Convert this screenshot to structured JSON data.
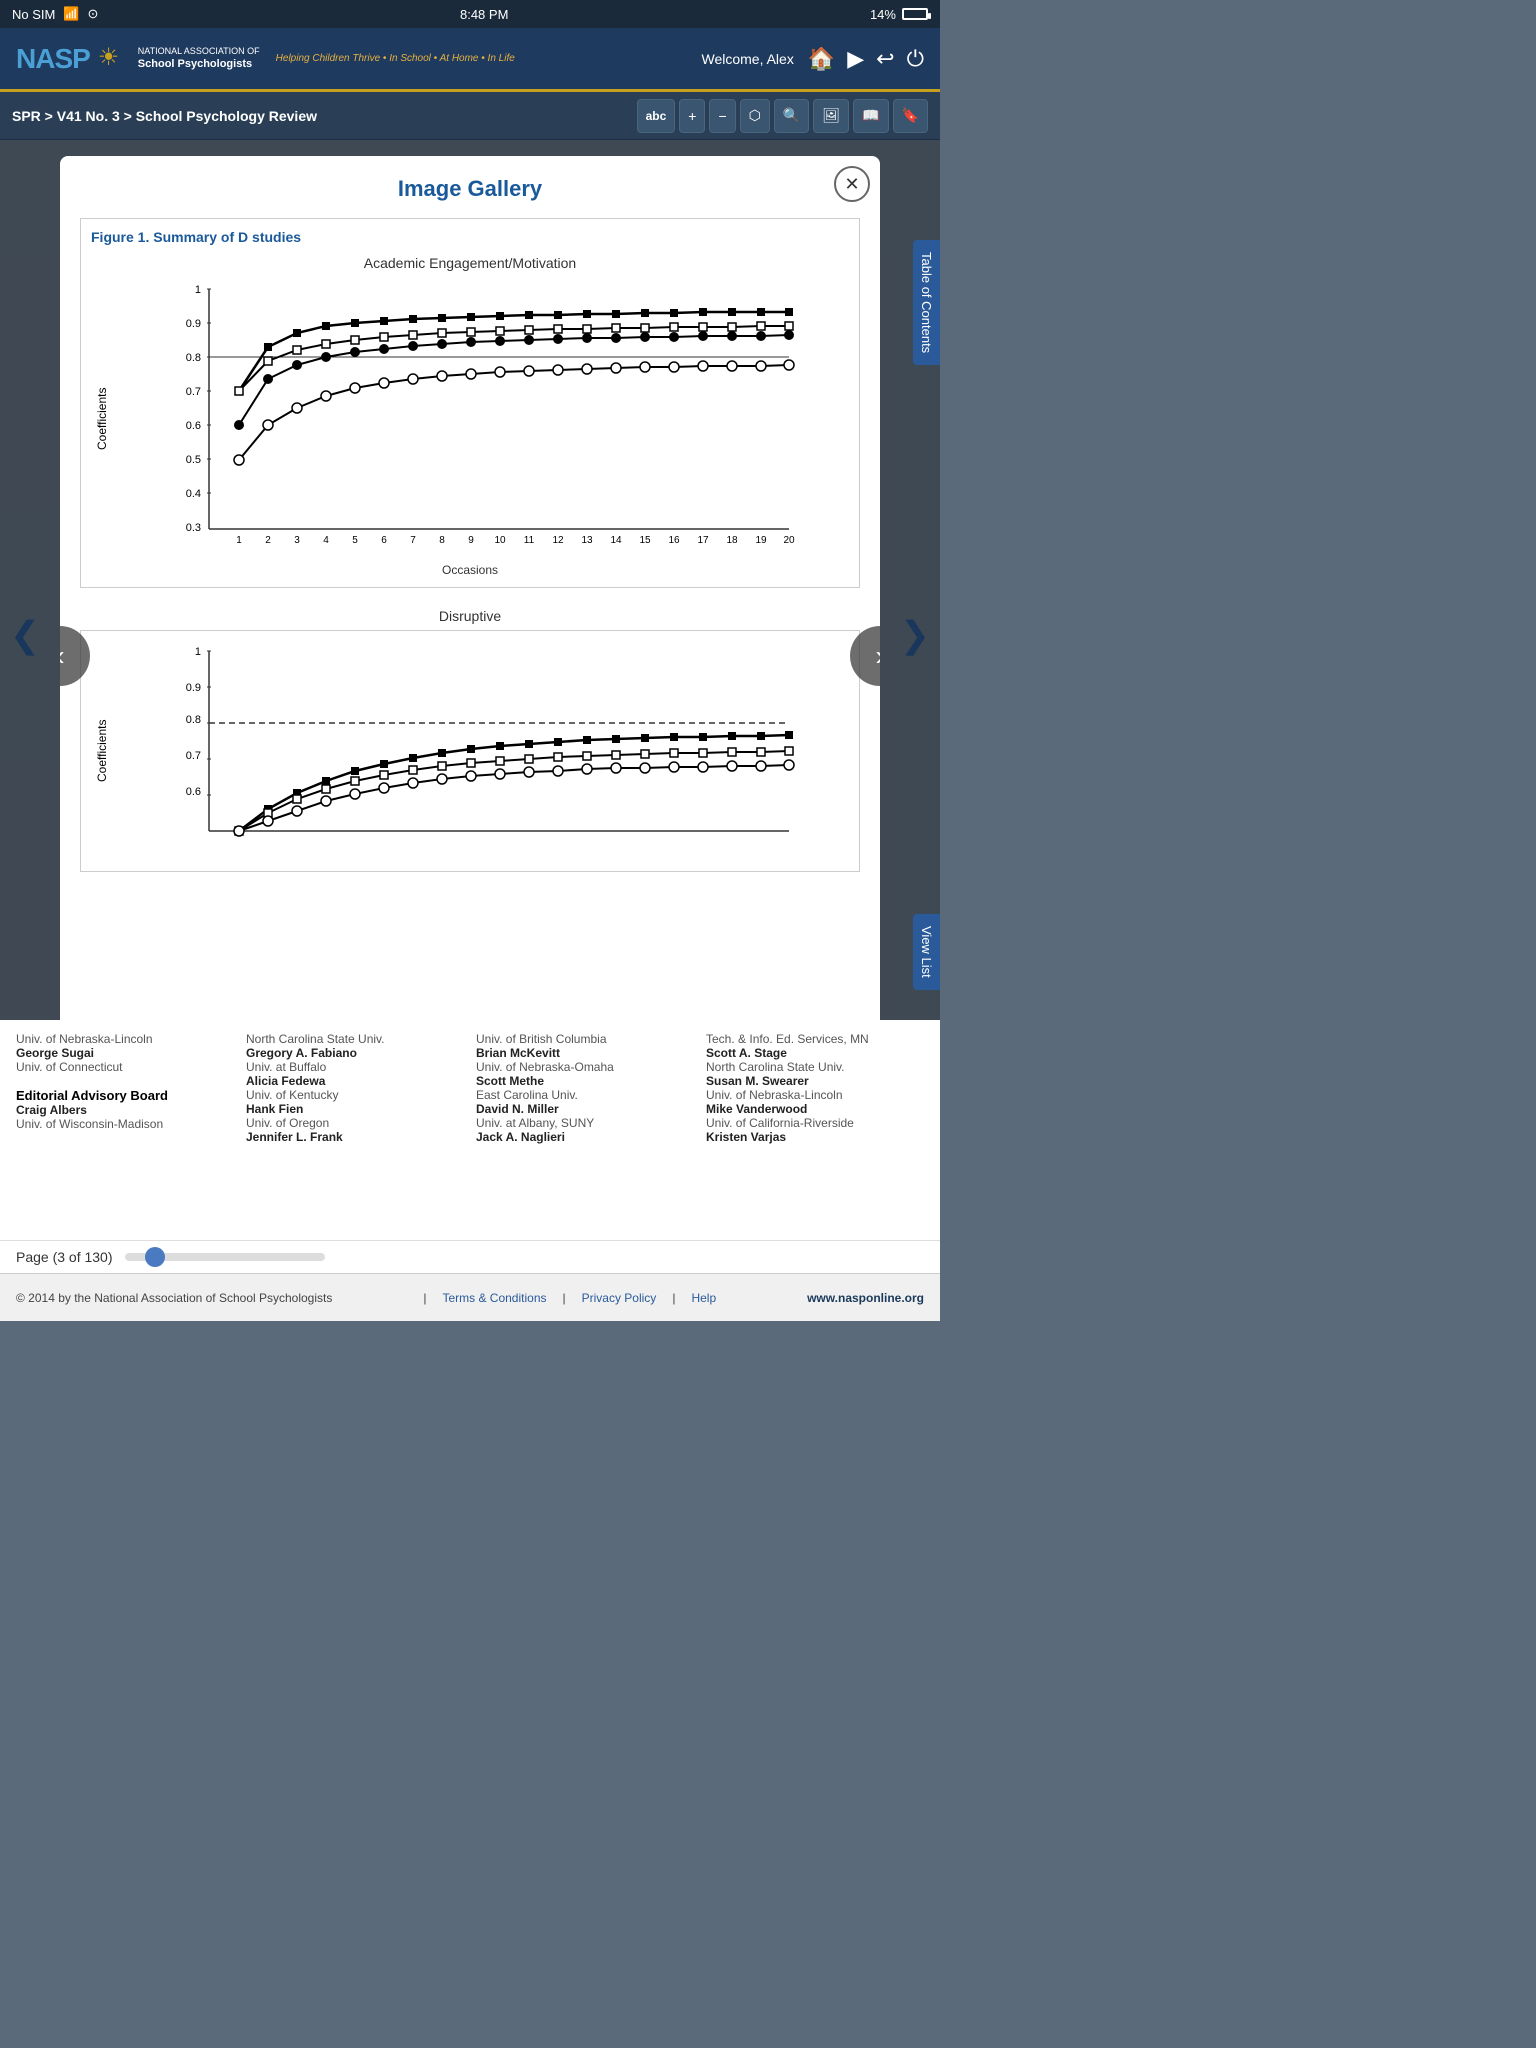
{
  "statusBar": {
    "carrier": "No SIM",
    "wifi": "WiFi",
    "time": "8:48 PM",
    "battery_pct": "14%"
  },
  "header": {
    "nasp_text": "NASP",
    "org_line1": "NATIONAL ASSOCIATION OF",
    "org_line2": "School Psychologists",
    "tagline": "Helping Children Thrive • In School • At Home • In Life",
    "welcome": "Welcome, Alex"
  },
  "navbar": {
    "breadcrumb": "SPR > V41 No. 3 > School Psychology Review",
    "toolbar": {
      "abc_label": "abc",
      "zoom_in": "+",
      "zoom_out": "−"
    }
  },
  "toc_tab": "Table of Contents",
  "view_list_btn": "View List",
  "gallery": {
    "title": "Image Gallery",
    "figure1_title": "Figure 1. Summary of D studies",
    "chart1": {
      "title": "Academic Engagement/Motivation",
      "y_label": "Coefficients",
      "x_label": "Occasions",
      "y_ticks": [
        "1",
        "0.9",
        "0.8",
        "0.7",
        "0.6",
        "0.5",
        "0.4",
        "0.3"
      ],
      "x_ticks": [
        "1",
        "2",
        "3",
        "4",
        "5",
        "6",
        "7",
        "8",
        "9",
        "10",
        "11",
        "12",
        "13",
        "14",
        "15",
        "16",
        "17",
        "18",
        "19",
        "20"
      ]
    },
    "chart2": {
      "title": "Disruptive",
      "y_label": "Coefficients",
      "x_label": "",
      "y_ticks": [
        "1",
        "0.9",
        "0.8",
        "0.7",
        "0.6"
      ]
    },
    "nav_prev": "‹",
    "nav_next": "›",
    "close": "✕"
  },
  "editorial": {
    "cols": [
      {
        "institution1": "Univ. of Nebraska-Lincoln",
        "name1": "George Sugai",
        "institution2": "Univ. of Connecticut",
        "sectionHeader": "Editorial Advisory Board",
        "name3": "Craig Albers",
        "institution3": "Univ. of Wisconsin-Madison"
      },
      {
        "institution1": "North Carolina State Univ.",
        "name1": "Gregory A. Fabiano",
        "institution2": "Univ. at Buffalo",
        "name2": "Alicia Fedewa",
        "institution2b": "Univ. of Kentucky",
        "name3": "Hank Fien",
        "institution3": "Univ. of Oregon",
        "name4": "Jennifer L. Frank"
      },
      {
        "institution1": "Univ. of British Columbia",
        "name1": "Brian McKevitt",
        "institution2": "Univ. of Nebraska-Omaha",
        "name2": "Scott Methe",
        "institution2b": "East Carolina Univ.",
        "name3": "David N. Miller",
        "institution3": "Univ. at Albany, SUNY",
        "name4": "Jack A. Naglieri"
      },
      {
        "institution1": "Tech. & Info. Ed. Services, MN",
        "name1": "Scott A. Stage",
        "institution2": "North Carolina State Univ.",
        "name2": "Susan M. Swearer",
        "institution2b": "Univ. of Nebraska-Lincoln",
        "name3": "Mike Vanderwood",
        "institution3": "Univ. of California-Riverside",
        "name4": "Kristen Varjas"
      }
    ]
  },
  "footer": {
    "copyright": "© 2014 by the National Association of School Psychologists",
    "terms": "Terms & Conditions",
    "privacy": "Privacy Policy",
    "help": "Help",
    "website": "www.nasponline.org"
  },
  "pageIndicator": {
    "label": "Page (3 of 130)"
  }
}
